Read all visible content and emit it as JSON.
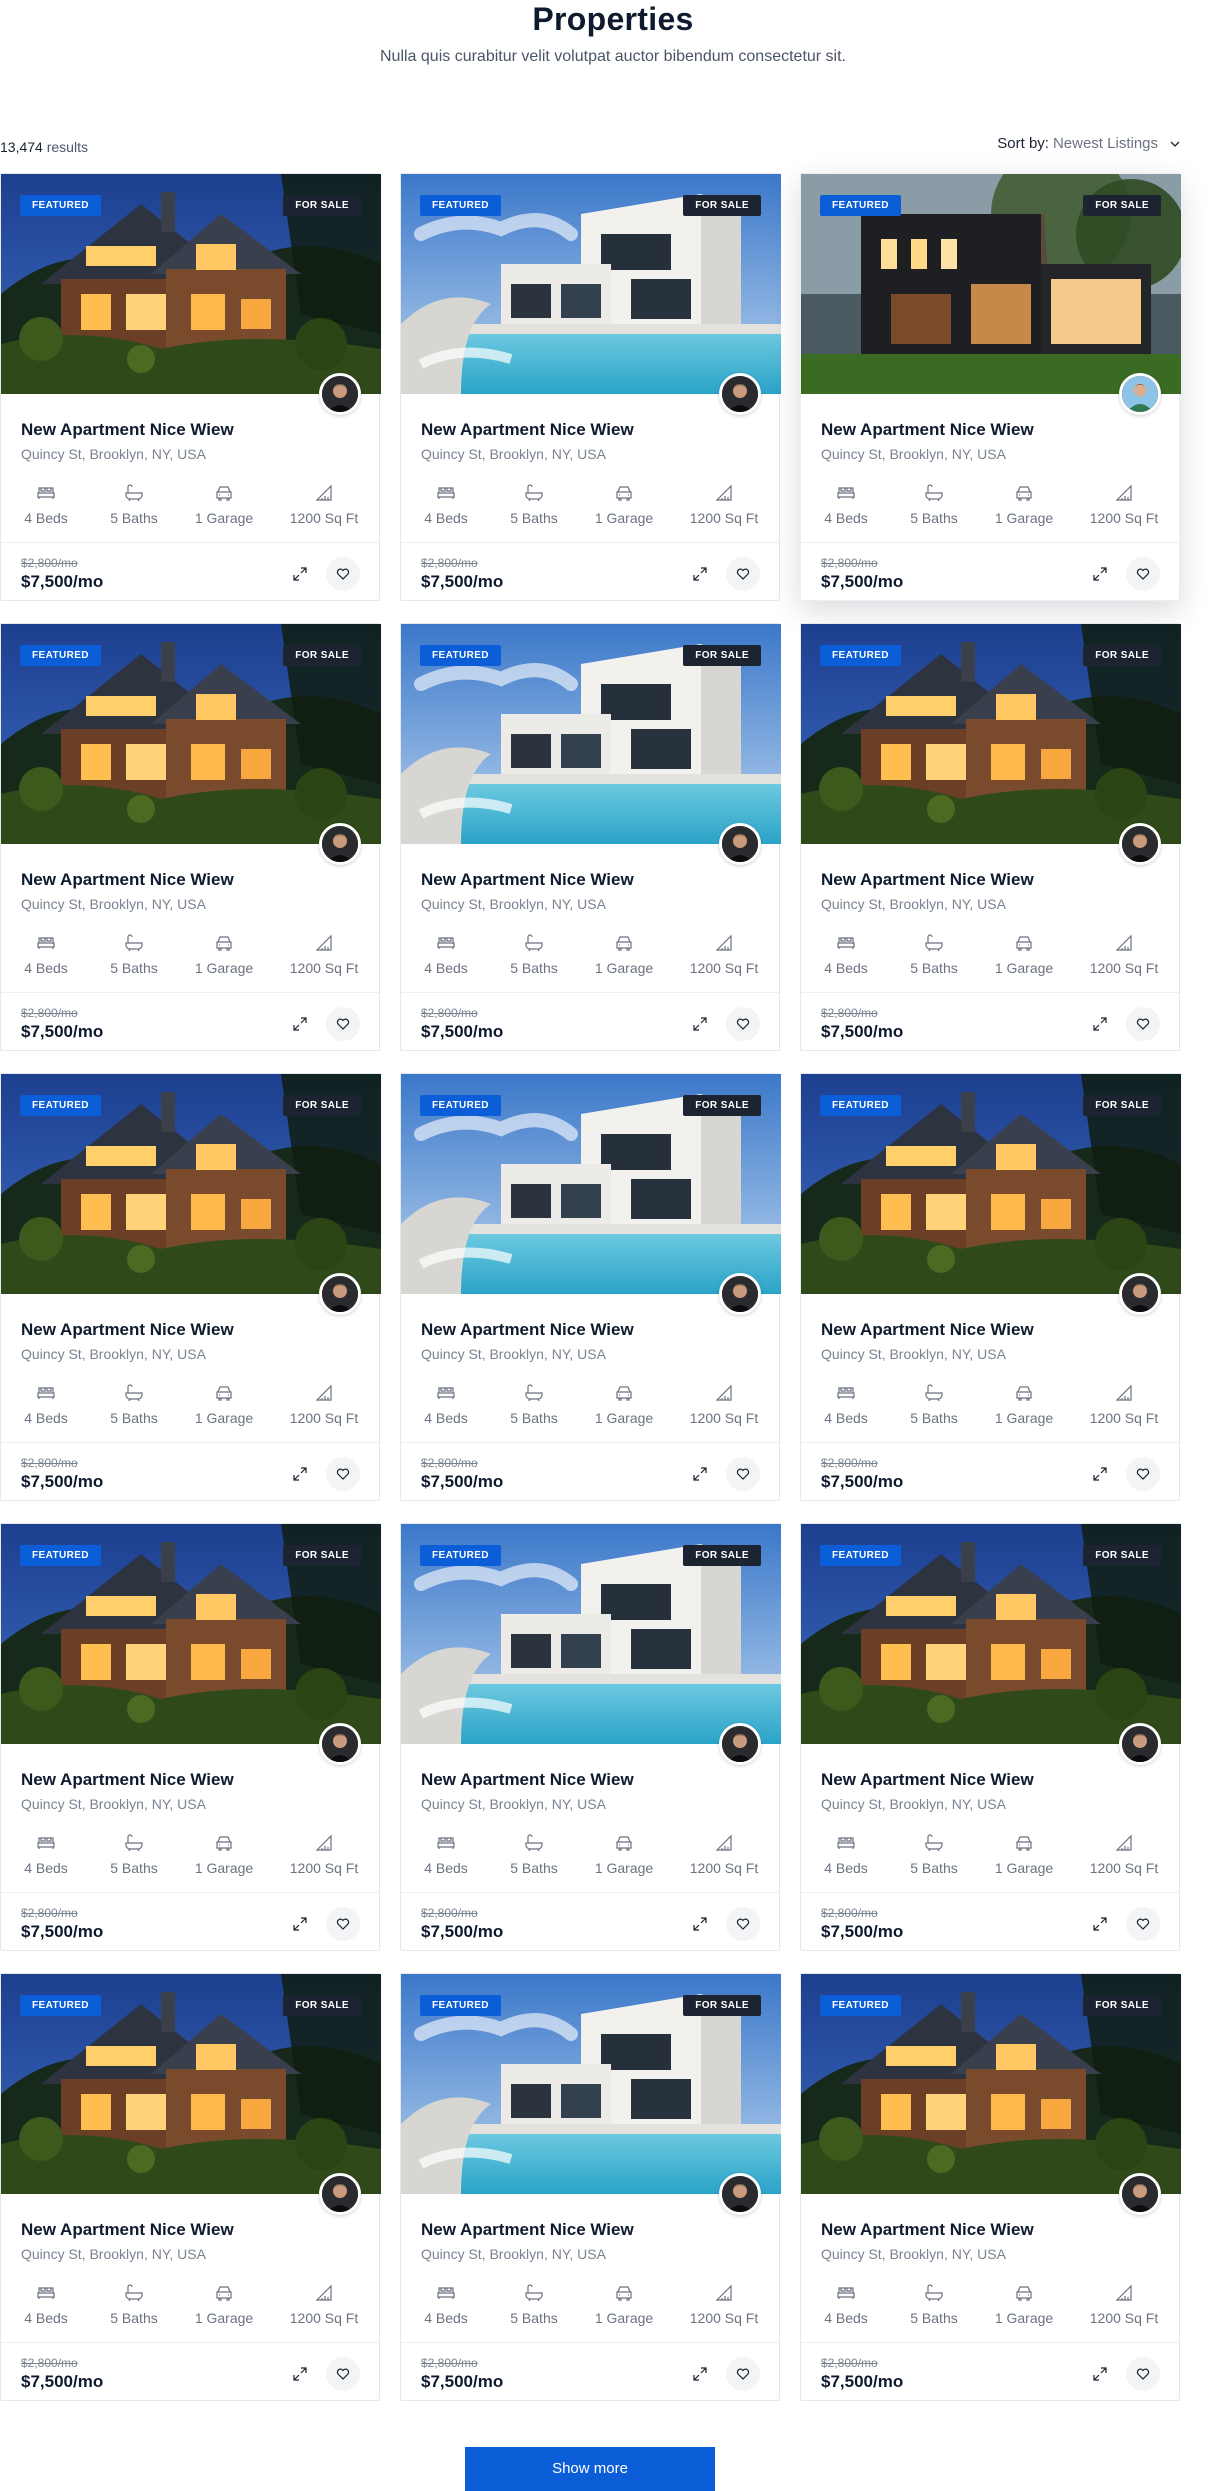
{
  "header": {
    "title": "Properties",
    "subtitle": "Nulla quis curabitur velit volutpat auctor bibendum consectetur sit."
  },
  "toolbar": {
    "results_count": "13,474",
    "results_label": "results",
    "sort_label": "Sort by:",
    "sort_value": "Newest Listings"
  },
  "colors": {
    "accent": "#0b5ed7",
    "dark_badge": "#1d2431",
    "heading": "#0e1a2e"
  },
  "listing": {
    "badge_featured": "FEATURED",
    "badge_status": "FOR SALE",
    "title": "New Apartment Nice Wiew",
    "address": "Quincy St, Brooklyn, NY, USA",
    "features": {
      "beds": "4 Beds",
      "baths": "5 Baths",
      "garage": "1 Garage",
      "area": "1200 Sq Ft"
    },
    "old_price": "$2,800/mo",
    "price": "$7,500/mo",
    "icons": {
      "beds": "bed-icon",
      "baths": "bathtub-icon",
      "garage": "car-icon",
      "area": "area-icon",
      "expand": "expand-icon",
      "favorite": "heart-icon"
    }
  },
  "cards": [
    {
      "image": "cabin",
      "agent": "man-dark"
    },
    {
      "image": "villa",
      "agent": "man-dark"
    },
    {
      "image": "modern",
      "agent": "man-green"
    },
    {
      "image": "cabin",
      "agent": "man-dark"
    },
    {
      "image": "villa",
      "agent": "man-dark"
    },
    {
      "image": "cabin",
      "agent": "man-dark"
    },
    {
      "image": "cabin",
      "agent": "man-dark"
    },
    {
      "image": "villa",
      "agent": "man-dark"
    },
    {
      "image": "cabin",
      "agent": "man-dark"
    },
    {
      "image": "cabin",
      "agent": "man-dark"
    },
    {
      "image": "villa",
      "agent": "man-dark"
    },
    {
      "image": "cabin",
      "agent": "man-dark"
    },
    {
      "image": "cabin",
      "agent": "man-dark"
    },
    {
      "image": "villa",
      "agent": "man-dark"
    },
    {
      "image": "cabin",
      "agent": "man-dark"
    }
  ],
  "show_more_label": "Show more"
}
